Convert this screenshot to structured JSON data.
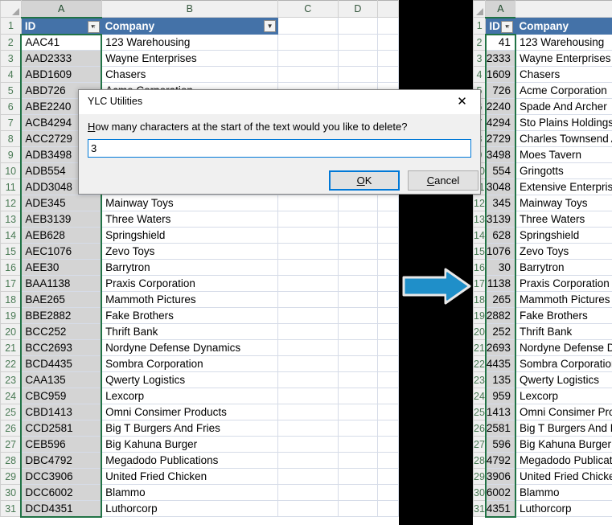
{
  "dialog": {
    "title": "YLC Utilities",
    "prompt_prefix": "H",
    "prompt_rest": "ow many characters at the start of the text would you like to delete?",
    "input_value": "3",
    "ok_prefix": "O",
    "ok_rest": "K",
    "cancel_prefix": "C",
    "cancel_rest": "ancel",
    "close_glyph": "✕"
  },
  "left_sheet": {
    "column_headers": [
      "A",
      "B",
      "C",
      "D"
    ],
    "selected_column": "A",
    "table_headers": [
      "ID",
      "Company"
    ],
    "rows": [
      {
        "n": "2",
        "id": "AAC41",
        "company": "123 Warehousing"
      },
      {
        "n": "3",
        "id": "AAD2333",
        "company": "Wayne Enterprises"
      },
      {
        "n": "4",
        "id": "ABD1609",
        "company": "Chasers"
      },
      {
        "n": "5",
        "id": "ABD726",
        "company": "Acme Corporation"
      },
      {
        "n": "6",
        "id": "ABE2240",
        "company": "Spade And Archer"
      },
      {
        "n": "7",
        "id": "ACB4294",
        "company": "Sto Plains Holdings"
      },
      {
        "n": "8",
        "id": "ACC2729",
        "company": "Charles Townsend Agency"
      },
      {
        "n": "9",
        "id": "ADB3498",
        "company": "Moes Tavern"
      },
      {
        "n": "10",
        "id": "ADB554",
        "company": "Gringotts"
      },
      {
        "n": "11",
        "id": "ADD3048",
        "company": "Extensive Enterprise"
      },
      {
        "n": "12",
        "id": "ADE345",
        "company": "Mainway Toys"
      },
      {
        "n": "13",
        "id": "AEB3139",
        "company": "Three Waters"
      },
      {
        "n": "14",
        "id": "AEB628",
        "company": "Springshield"
      },
      {
        "n": "15",
        "id": "AEC1076",
        "company": "Zevo Toys"
      },
      {
        "n": "16",
        "id": "AEE30",
        "company": "Barrytron"
      },
      {
        "n": "17",
        "id": "BAA1138",
        "company": "Praxis Corporation"
      },
      {
        "n": "18",
        "id": "BAE265",
        "company": "Mammoth Pictures"
      },
      {
        "n": "19",
        "id": "BBE2882",
        "company": "Fake Brothers"
      },
      {
        "n": "20",
        "id": "BCC252",
        "company": "Thrift Bank"
      },
      {
        "n": "21",
        "id": "BCC2693",
        "company": "Nordyne Defense Dynamics"
      },
      {
        "n": "22",
        "id": "BCD4435",
        "company": "Sombra Corporation"
      },
      {
        "n": "23",
        "id": "CAA135",
        "company": "Qwerty Logistics"
      },
      {
        "n": "24",
        "id": "CBC959",
        "company": "Lexcorp"
      },
      {
        "n": "25",
        "id": "CBD1413",
        "company": "Omni Consimer Products"
      },
      {
        "n": "26",
        "id": "CCD2581",
        "company": "Big T Burgers And Fries"
      },
      {
        "n": "27",
        "id": "CEB596",
        "company": "Big Kahuna Burger"
      },
      {
        "n": "28",
        "id": "DBC4792",
        "company": "Megadodo Publications"
      },
      {
        "n": "29",
        "id": "DCC3906",
        "company": "United Fried Chicken"
      },
      {
        "n": "30",
        "id": "DCC6002",
        "company": "Blammo"
      },
      {
        "n": "31",
        "id": "DCD4351",
        "company": "Luthorcorp"
      }
    ]
  },
  "right_sheet": {
    "column_headers": [
      "A"
    ],
    "selected_column": "A",
    "table_headers": [
      "ID",
      "Company"
    ],
    "rows": [
      {
        "n": "2",
        "id": "41",
        "company": "123 Warehousing"
      },
      {
        "n": "3",
        "id": "2333",
        "company": "Wayne Enterprises"
      },
      {
        "n": "4",
        "id": "1609",
        "company": "Chasers"
      },
      {
        "n": "5",
        "id": "726",
        "company": "Acme Corporation"
      },
      {
        "n": "6",
        "id": "2240",
        "company": "Spade And Archer"
      },
      {
        "n": "7",
        "id": "4294",
        "company": "Sto Plains Holdings"
      },
      {
        "n": "8",
        "id": "2729",
        "company": "Charles Townsend Agency"
      },
      {
        "n": "9",
        "id": "3498",
        "company": "Moes Tavern"
      },
      {
        "n": "10",
        "id": "554",
        "company": "Gringotts"
      },
      {
        "n": "11",
        "id": "3048",
        "company": "Extensive Enterprise"
      },
      {
        "n": "12",
        "id": "345",
        "company": "Mainway Toys"
      },
      {
        "n": "13",
        "id": "3139",
        "company": "Three Waters"
      },
      {
        "n": "14",
        "id": "628",
        "company": "Springshield"
      },
      {
        "n": "15",
        "id": "1076",
        "company": "Zevo Toys"
      },
      {
        "n": "16",
        "id": "30",
        "company": "Barrytron"
      },
      {
        "n": "17",
        "id": "1138",
        "company": "Praxis Corporation"
      },
      {
        "n": "18",
        "id": "265",
        "company": "Mammoth Pictures"
      },
      {
        "n": "19",
        "id": "2882",
        "company": "Fake Brothers"
      },
      {
        "n": "20",
        "id": "252",
        "company": "Thrift Bank"
      },
      {
        "n": "21",
        "id": "2693",
        "company": "Nordyne Defense Dynamics"
      },
      {
        "n": "22",
        "id": "4435",
        "company": "Sombra Corporation"
      },
      {
        "n": "23",
        "id": "135",
        "company": "Qwerty Logistics"
      },
      {
        "n": "24",
        "id": "959",
        "company": "Lexcorp"
      },
      {
        "n": "25",
        "id": "1413",
        "company": "Omni Consimer Products"
      },
      {
        "n": "26",
        "id": "2581",
        "company": "Big T Burgers And Fries"
      },
      {
        "n": "27",
        "id": "596",
        "company": "Big Kahuna Burger"
      },
      {
        "n": "28",
        "id": "4792",
        "company": "Megadodo Publications"
      },
      {
        "n": "29",
        "id": "3906",
        "company": "United Fried Chicken"
      },
      {
        "n": "30",
        "id": "6002",
        "company": "Blammo"
      },
      {
        "n": "31",
        "id": "4351",
        "company": "Luthorcorp"
      }
    ]
  },
  "arrow": {
    "direction": "right",
    "color": "#1f8fc9"
  },
  "colors": {
    "table_header": "#4472a8",
    "selection_border": "#217346",
    "focus_blue": "#0078d7",
    "arrow_blue": "#1f8fc9"
  }
}
